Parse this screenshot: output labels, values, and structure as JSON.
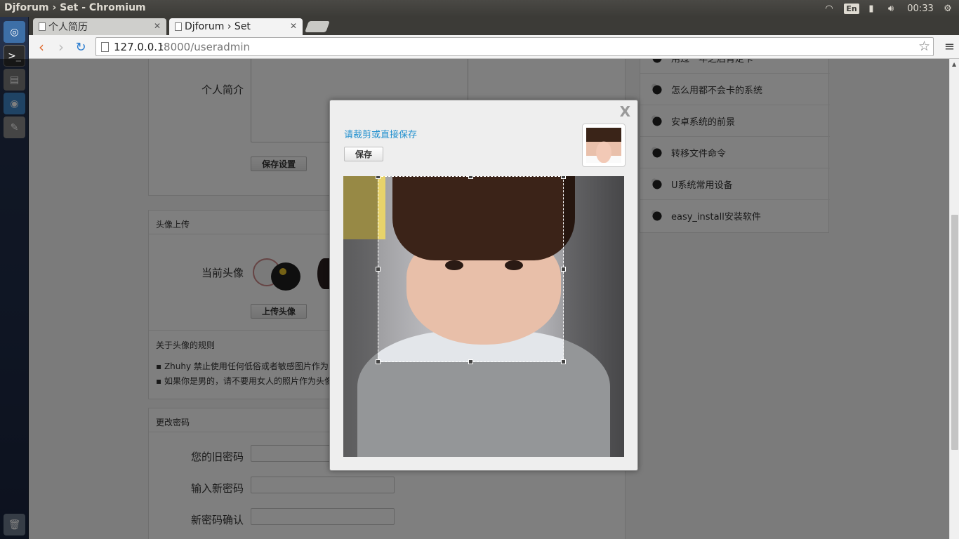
{
  "window": {
    "title": "Djforum › Set - Chromium"
  },
  "tray": {
    "lang": "En",
    "time": "00:33"
  },
  "tabs": [
    {
      "label": "个人简历",
      "active": false
    },
    {
      "label": "Djforum › Set",
      "active": true
    }
  ],
  "address": {
    "host": "127.0.0.1",
    "rest": ":8000/useradmin"
  },
  "profile": {
    "intro_label": "个人简介",
    "save_settings": "保存设置"
  },
  "avatar_panel": {
    "title": "头像上传",
    "current_label": "当前头像",
    "upload_button": "上传头像",
    "rules_title": "关于头像的规则",
    "rules": [
      "Zhuhy 禁止使用任何低俗或者敏感图片作为",
      "如果你是男的，请不要用女人的照片作为头像"
    ]
  },
  "password_panel": {
    "title": "更改密码",
    "old_label": "您的旧密码",
    "new_label": "输入新密码",
    "confirm_label": "新密码确认"
  },
  "sidebar": {
    "items": [
      "用过一年之后肯定卡",
      "怎么用都不会卡的系统",
      "安卓系统的前景",
      "转移文件命令",
      "U系统常用设备",
      "easy_install安装软件"
    ]
  },
  "modal": {
    "close": "X",
    "hint": "请裁剪或直接保存",
    "save": "保存"
  }
}
